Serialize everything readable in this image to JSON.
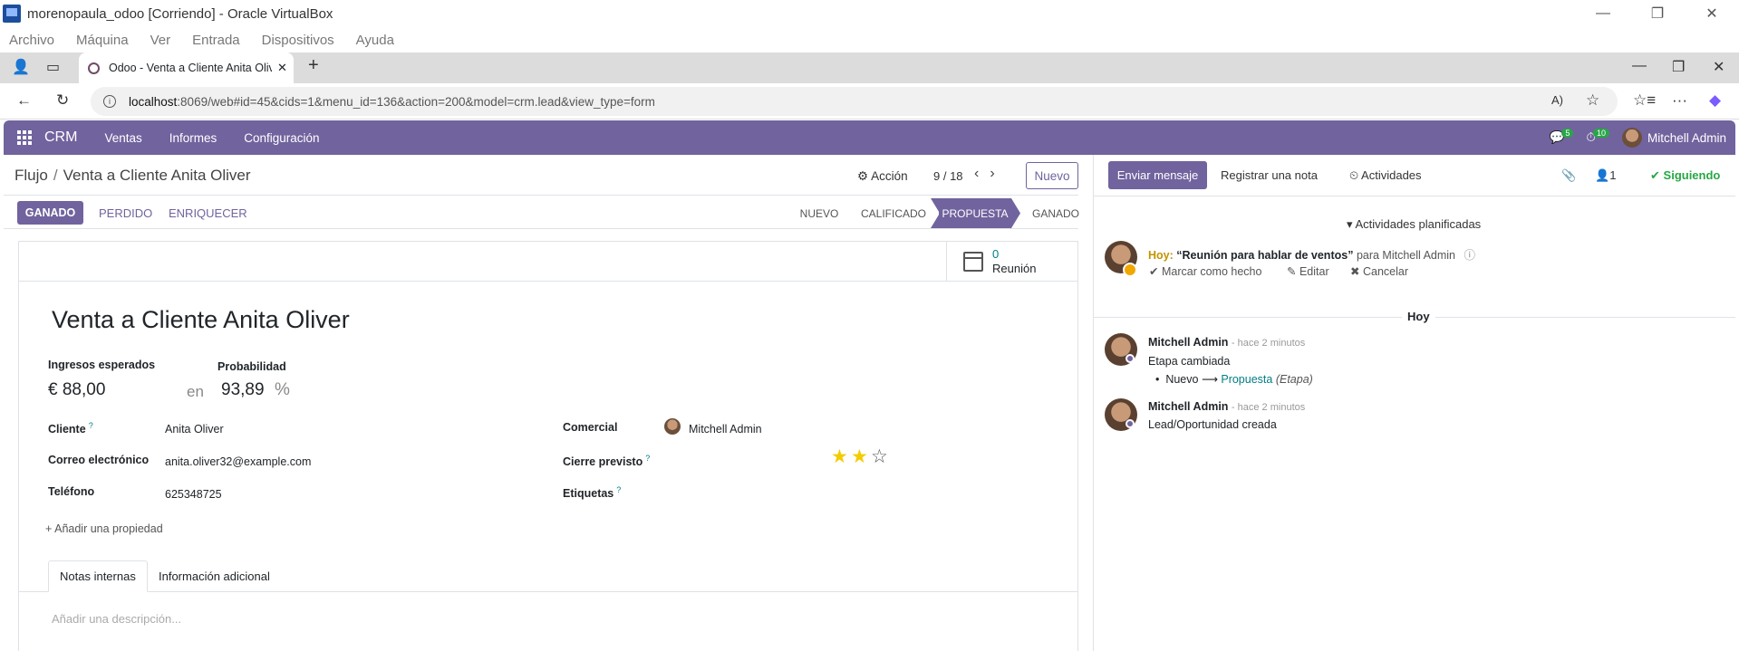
{
  "vbox": {
    "title": "morenopaula_odoo [Corriendo] - Oracle VirtualBox",
    "menu": [
      "Archivo",
      "Máquina",
      "Ver",
      "Entrada",
      "Dispositivos",
      "Ayuda"
    ]
  },
  "browser": {
    "tab_title": "Odoo - Venta a Cliente Anita Oliver",
    "url_host": "localhost",
    "url_rest": ":8069/web#id=45&cids=1&menu_id=136&action=200&model=crm.lead&view_type=form"
  },
  "navbar": {
    "brand": "CRM",
    "menus": [
      "Ventas",
      "Informes",
      "Configuración"
    ],
    "messages_count": "5",
    "activities_count": "10",
    "user": "Mitchell Admin"
  },
  "control": {
    "breadcrumb_parent": "Flujo",
    "breadcrumb_sep": "/",
    "breadcrumb_current": "Venta a Cliente Anita Oliver",
    "action_label": "Acción",
    "pager": "9 / 18",
    "new_label": "Nuevo"
  },
  "statusbar": {
    "won": "GANADO",
    "lost": "PERDIDO",
    "enrich": "ENRIQUECER",
    "stages": [
      "NUEVO",
      "CALIFICADO",
      "PROPUESTA",
      "GANADO"
    ],
    "active_stage": "PROPUESTA"
  },
  "smart_button": {
    "count": "0",
    "label": "Reunión"
  },
  "record": {
    "title": "Venta a Cliente Anita Oliver",
    "expected_revenue_label": "Ingresos esperados",
    "expected_revenue": "€ 88,00",
    "at_label": "en",
    "probability_label": "Probabilidad",
    "probability": "93,89",
    "percent": "%",
    "customer_label": "Cliente",
    "customer": "Anita Oliver",
    "email_label": "Correo electrónico",
    "email": "anita.oliver32@example.com",
    "phone_label": "Teléfono",
    "phone": "625348725",
    "salesperson_label": "Comercial",
    "salesperson": "Mitchell Admin",
    "deadline_label": "Cierre previsto",
    "priority": 2,
    "priority_max": 3,
    "tags_label": "Etiquetas",
    "help": "?",
    "add_property": "Añadir una propiedad"
  },
  "form_tabs": [
    "Notas internas",
    "Información adicional"
  ],
  "description_placeholder": "Añadir una descripción...",
  "chatter": {
    "send_message": "Enviar mensaje",
    "log_note": "Registrar una nota",
    "activities": "Actividades",
    "followers": "1",
    "following": "Siguiendo",
    "planned_header": "Actividades planificadas",
    "activity": {
      "when": "Hoy:",
      "summary": "“Reunión para hablar de ventos”",
      "for_label": "para Mitchell Admin",
      "done": "Marcar como hecho",
      "edit": "Editar",
      "cancel": "Cancelar"
    },
    "day": "Hoy",
    "messages": [
      {
        "author": "Mitchell Admin",
        "time": "- hace 2 minutos",
        "body": "Etapa cambiada",
        "from": "Nuevo",
        "to": "Propuesta",
        "field": "(Etapa)"
      },
      {
        "author": "Mitchell Admin",
        "time": "- hace 2 minutos",
        "body": "Lead/Oportunidad creada"
      }
    ]
  },
  "colors": {
    "primary": "#71639e",
    "teal": "#017e84",
    "star": "#f3cc00",
    "success": "#28a745"
  }
}
